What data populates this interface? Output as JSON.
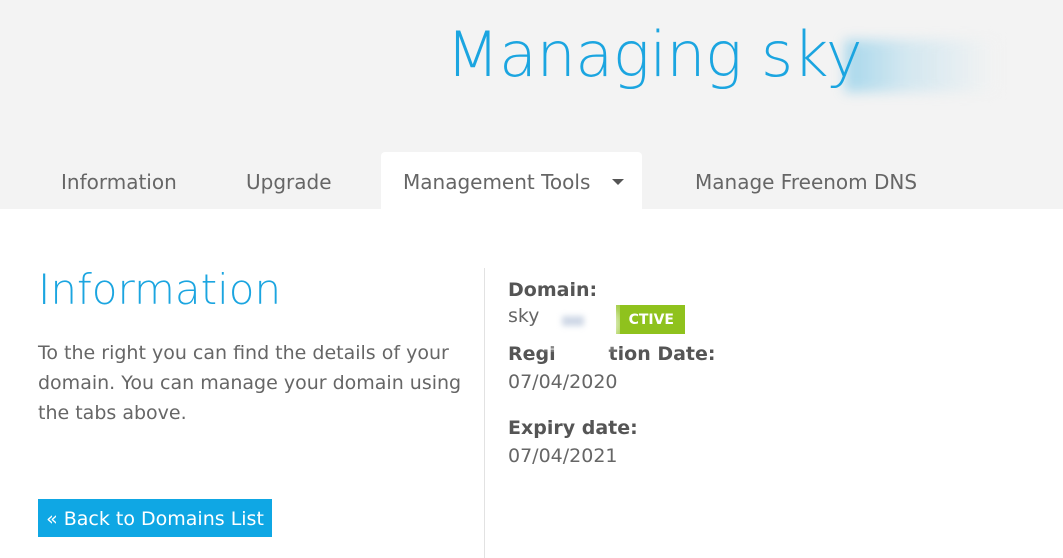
{
  "header": {
    "title": "Managing sky"
  },
  "tabs": [
    {
      "label": "Information"
    },
    {
      "label": "Upgrade"
    },
    {
      "label": "Management Tools"
    },
    {
      "label": "Manage Freenom DNS"
    }
  ],
  "info": {
    "title": "Information",
    "description": "To the right you can find the details of your domain. You can manage your domain using the tabs above.",
    "back_button": "« Back to Domains List"
  },
  "details": {
    "domain_label": "Domain:",
    "domain_value": "sky",
    "status_badge": "CTIVE",
    "registration_label": "Regi        tion Date:",
    "registration_value": "07/04/2020",
    "expiry_label": "Expiry date:",
    "expiry_value": "07/04/2021"
  },
  "colors": {
    "accent": "#1ba5e0",
    "button": "#0fa7e4",
    "badge": "#8fc21d",
    "header_bg": "#f3f3f3"
  }
}
